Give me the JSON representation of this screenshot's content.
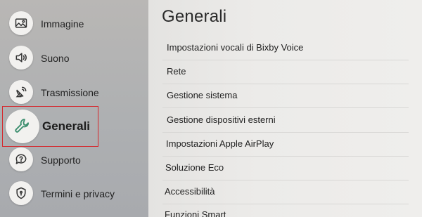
{
  "sidebar": {
    "items": [
      {
        "label": "Immagine",
        "icon": "image-icon"
      },
      {
        "label": "Suono",
        "icon": "speaker-icon"
      },
      {
        "label": "Trasmissione",
        "icon": "satellite-icon"
      },
      {
        "label": "Generali",
        "icon": "wrench-icon",
        "active": true
      },
      {
        "label": "Supporto",
        "icon": "support-icon"
      },
      {
        "label": "Termini e privacy",
        "icon": "shield-icon"
      }
    ]
  },
  "panel": {
    "title": "Generali",
    "items": [
      {
        "label": "Impostazioni vocali di Bixby Voice"
      },
      {
        "label": "Rete"
      },
      {
        "label": "Gestione sistema"
      },
      {
        "label": "Gestione dispositivi esterni"
      },
      {
        "label": "Impostazioni Apple AirPlay"
      },
      {
        "label": "Soluzione Eco"
      },
      {
        "label": "Accessibilità"
      },
      {
        "label": "Funzioni Smart"
      }
    ]
  },
  "colors": {
    "sidebar_bg": "#b2b3b4",
    "panel_bg": "#ebeae8",
    "highlight_border": "#d6262b",
    "active_icon": "#3d8f6f"
  }
}
